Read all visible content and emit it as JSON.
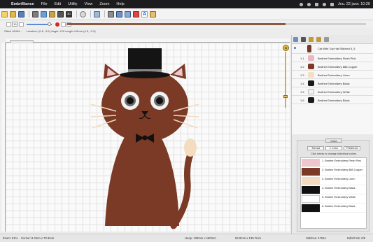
{
  "menubar": {
    "app_name": "Embrilliance",
    "items": [
      "File",
      "Edit",
      "Utility",
      "View",
      "Zoom",
      "Help"
    ],
    "clock": "Jeu. 22 janv. 10:20"
  },
  "toolbar2": {
    "stitch_box": "10",
    "progress_fraction": 0.73
  },
  "info": {
    "stitch": "Stitch 16434...",
    "location": "Location: (0.6, -8.1)  Angle:-2.5  Length:4.5mm  (4.5, -0.3)"
  },
  "canvas": {
    "tab_label": ""
  },
  "status": {
    "zoom": "Zoom: 91%",
    "cursor": "Cursor: 8.3mm x 70.3mm",
    "hoop": "Hoop: 130mm x 180mm",
    "size": "84.0mm x 139.7mm",
    "stitches": "Stitches: 17614",
    "ndls": "Ndls/Cols: 6/6"
  },
  "stop_list": {
    "header_label": "Cat With Top Hat Stitched 5_5",
    "stops": [
      {
        "num": "1:1",
        "name": "Brother Embroidery Flesh Pink",
        "color": "#e9b9c0"
      },
      {
        "num": "1:2",
        "name": "Brother Embroidery 888 Copper",
        "color": "#7a3a25"
      },
      {
        "num": "1:3",
        "name": "Brother Embroidery Linen",
        "color": "#f3dfc4"
      },
      {
        "num": "1:4",
        "name": "Brother Embroidery Black",
        "color": "#1a1a1a"
      },
      {
        "num": "1:5",
        "name": "Brother Embroidery White",
        "color": "#f2f2f2"
      },
      {
        "num": "1:6",
        "name": "Brother Embroidery Black",
        "color": "#1a1a1a"
      }
    ]
  },
  "color_panel": {
    "title": "Color",
    "segments": [
      "Thread",
      "1 Color",
      "Preferred"
    ],
    "hint": "Click below to change individual colors.",
    "threads": [
      {
        "label": "1. Brother Embroidery Flesh Pink",
        "color": "#efc6cd"
      },
      {
        "label": "2. Brother Embroidery 888 Copper",
        "color": "#7a3a25"
      },
      {
        "label": "3. Brother Embroidery Linen",
        "color": "#f3dcc0"
      },
      {
        "label": "4. Brother Embroidery Black",
        "color": "#111111"
      },
      {
        "label": "5. Brother Embroidery White",
        "color": "#ffffff"
      },
      {
        "label": "6. Brother Embroidery Black",
        "color": "#111111"
      }
    ]
  }
}
